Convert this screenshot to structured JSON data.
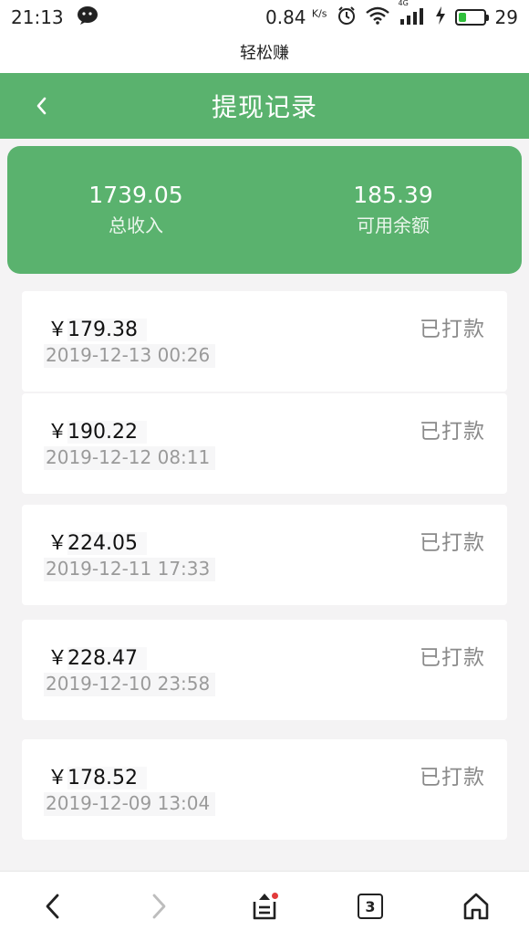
{
  "status_bar": {
    "time": "21:13",
    "speed_value": "0.84",
    "speed_unit": "K/s",
    "network": "4G",
    "battery_level": "29",
    "battery_fraction": 0.3
  },
  "app_name": "轻松赚",
  "header": {
    "title": "提现记录"
  },
  "summary": {
    "total_income_value": "1739.05",
    "total_income_label": "总收入",
    "available_balance_value": "185.39",
    "available_balance_label": "可用余额"
  },
  "records": [
    {
      "currency": "￥",
      "amount": "179.38",
      "time": "2019-12-13 00:26",
      "status": "已打款"
    },
    {
      "currency": "￥",
      "amount": "190.22",
      "time": "2019-12-12 08:11",
      "status": "已打款"
    },
    {
      "currency": "￥",
      "amount": "224.05",
      "time": "2019-12-11 17:33",
      "status": "已打款"
    },
    {
      "currency": "￥",
      "amount": "228.47",
      "time": "2019-12-10 23:58",
      "status": "已打款"
    },
    {
      "currency": "￥",
      "amount": "178.52",
      "time": "2019-12-09 13:04",
      "status": "已打款"
    }
  ],
  "bottom_nav": {
    "tabs_count": "3"
  },
  "colors": {
    "primary": "#5ab26e",
    "background": "#f4f3f4",
    "status_text": "#8a8a8a"
  }
}
